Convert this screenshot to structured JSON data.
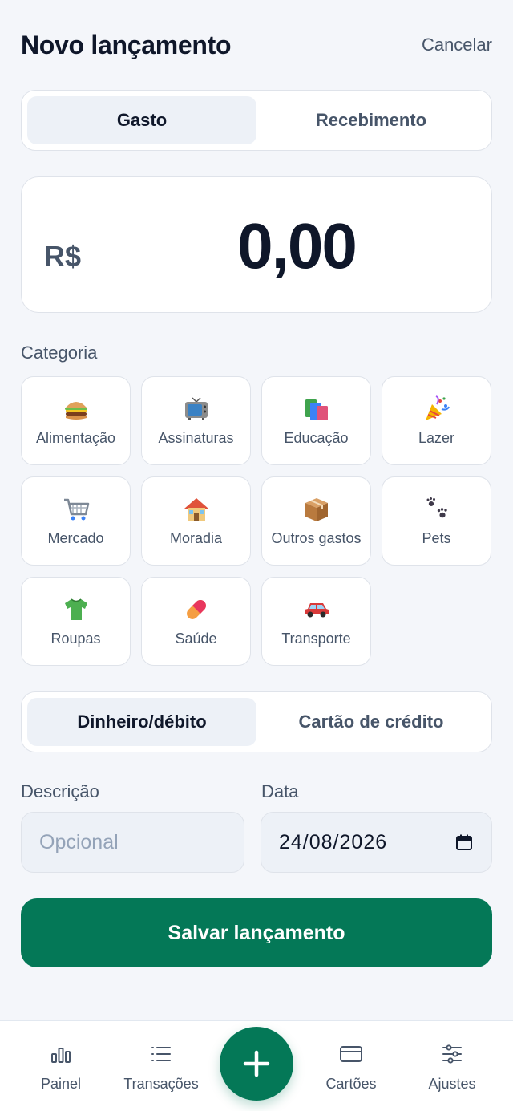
{
  "header": {
    "title": "Novo lançamento",
    "cancel_label": "Cancelar"
  },
  "type_toggle": {
    "options": [
      "Gasto",
      "Recebimento"
    ],
    "selected": "Gasto"
  },
  "amount": {
    "currency": "R$",
    "value": "0,00"
  },
  "category": {
    "label": "Categoria",
    "items": [
      {
        "label": "Alimentação",
        "icon": "burger-icon"
      },
      {
        "label": "Assinaturas",
        "icon": "tv-icon"
      },
      {
        "label": "Educação",
        "icon": "books-icon"
      },
      {
        "label": "Lazer",
        "icon": "party-popper-icon"
      },
      {
        "label": "Mercado",
        "icon": "shopping-cart-icon"
      },
      {
        "label": "Moradia",
        "icon": "house-icon"
      },
      {
        "label": "Outros gastos",
        "icon": "package-icon"
      },
      {
        "label": "Pets",
        "icon": "paw-prints-icon"
      },
      {
        "label": "Roupas",
        "icon": "tshirt-icon"
      },
      {
        "label": "Saúde",
        "icon": "pill-icon"
      },
      {
        "label": "Transporte",
        "icon": "car-icon"
      }
    ]
  },
  "payment_toggle": {
    "options": [
      "Dinheiro/débito",
      "Cartão de crédito"
    ],
    "selected": "Dinheiro/débito"
  },
  "description": {
    "label": "Descrição",
    "placeholder": "Opcional",
    "value": ""
  },
  "date": {
    "label": "Data",
    "value": "24/08/2026"
  },
  "save_label": "Salvar lançamento",
  "nav": {
    "items": [
      {
        "label": "Painel",
        "icon": "bar-chart-icon"
      },
      {
        "label": "Transações",
        "icon": "list-icon"
      },
      {
        "label": "Cartões",
        "icon": "credit-card-icon"
      },
      {
        "label": "Ajustes",
        "icon": "sliders-icon"
      }
    ],
    "fab_icon": "plus-icon"
  },
  "colors": {
    "accent": "#047857",
    "background": "#f4f6fa",
    "text": "#0f172a",
    "muted": "#475569"
  }
}
